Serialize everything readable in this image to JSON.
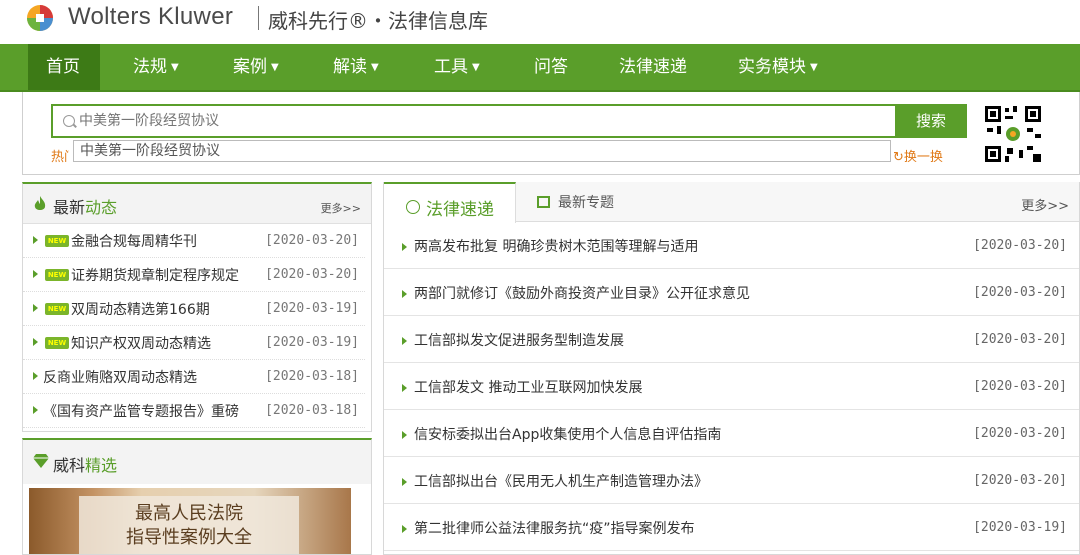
{
  "header": {
    "brand": "Wolters Kluwer",
    "subtitle": "威科先行®・法律信息库"
  },
  "nav": {
    "items": [
      {
        "label": "首页",
        "caret": false
      },
      {
        "label": "法规",
        "caret": true
      },
      {
        "label": "案例",
        "caret": true
      },
      {
        "label": "解读",
        "caret": true
      },
      {
        "label": "工具",
        "caret": true
      },
      {
        "label": "问答",
        "caret": false
      },
      {
        "label": "法律速递",
        "caret": false
      },
      {
        "label": "实务模块",
        "caret": true
      }
    ]
  },
  "search": {
    "placeholder": "中美第一阶段经贸协议",
    "button": "搜索",
    "suggestion": "中美第一阶段经贸协议",
    "hot_label": "热门",
    "refresh": "换一换"
  },
  "left_news": {
    "title_prefix": "最新",
    "title_highlight": "动态",
    "more": "更多>>",
    "new_badge": "NEW",
    "items": [
      {
        "text": "金融合规每周精华刊",
        "date": "[2020-03-20]",
        "new": true
      },
      {
        "text": "证券期货规章制定程序规定",
        "date": "[2020-03-20]",
        "new": true
      },
      {
        "text": "双周动态精选第166期",
        "date": "[2020-03-19]",
        "new": true
      },
      {
        "text": "知识产权双周动态精选",
        "date": "[2020-03-19]",
        "new": true
      },
      {
        "text": "反商业贿赂双周动态精选",
        "date": "[2020-03-18]",
        "new": false
      },
      {
        "text": "《国有资产监管专题报告》重磅",
        "date": "[2020-03-18]",
        "new": false
      }
    ]
  },
  "left_featured": {
    "title_prefix": "威科",
    "title_highlight": "精选",
    "book_line1": "最高人民法院",
    "book_line2": "指导性案例大全"
  },
  "right_news": {
    "tab_active": "法律速递",
    "tab_other": "最新专题",
    "more": "更多>>",
    "items": [
      {
        "text": "两高发布批复 明确珍贵树木范围等理解与适用",
        "date": "[2020-03-20]"
      },
      {
        "text": "两部门就修订《鼓励外商投资产业目录》公开征求意见",
        "date": "[2020-03-20]"
      },
      {
        "text": "工信部拟发文促进服务型制造发展",
        "date": "[2020-03-20]"
      },
      {
        "text": "工信部发文 推动工业互联网加快发展",
        "date": "[2020-03-20]"
      },
      {
        "text": "信安标委拟出台App收集使用个人信息自评估指南",
        "date": "[2020-03-20]"
      },
      {
        "text": "工信部拟出台《民用无人机生产制造管理办法》",
        "date": "[2020-03-20]"
      },
      {
        "text": "第二批律师公益法律服务抗“疫”指导案例发布",
        "date": "[2020-03-19]"
      }
    ]
  },
  "colors": {
    "brand_green": "#5a9e2a",
    "nav_active": "#3d7a16",
    "hot_orange": "#e07a18"
  }
}
